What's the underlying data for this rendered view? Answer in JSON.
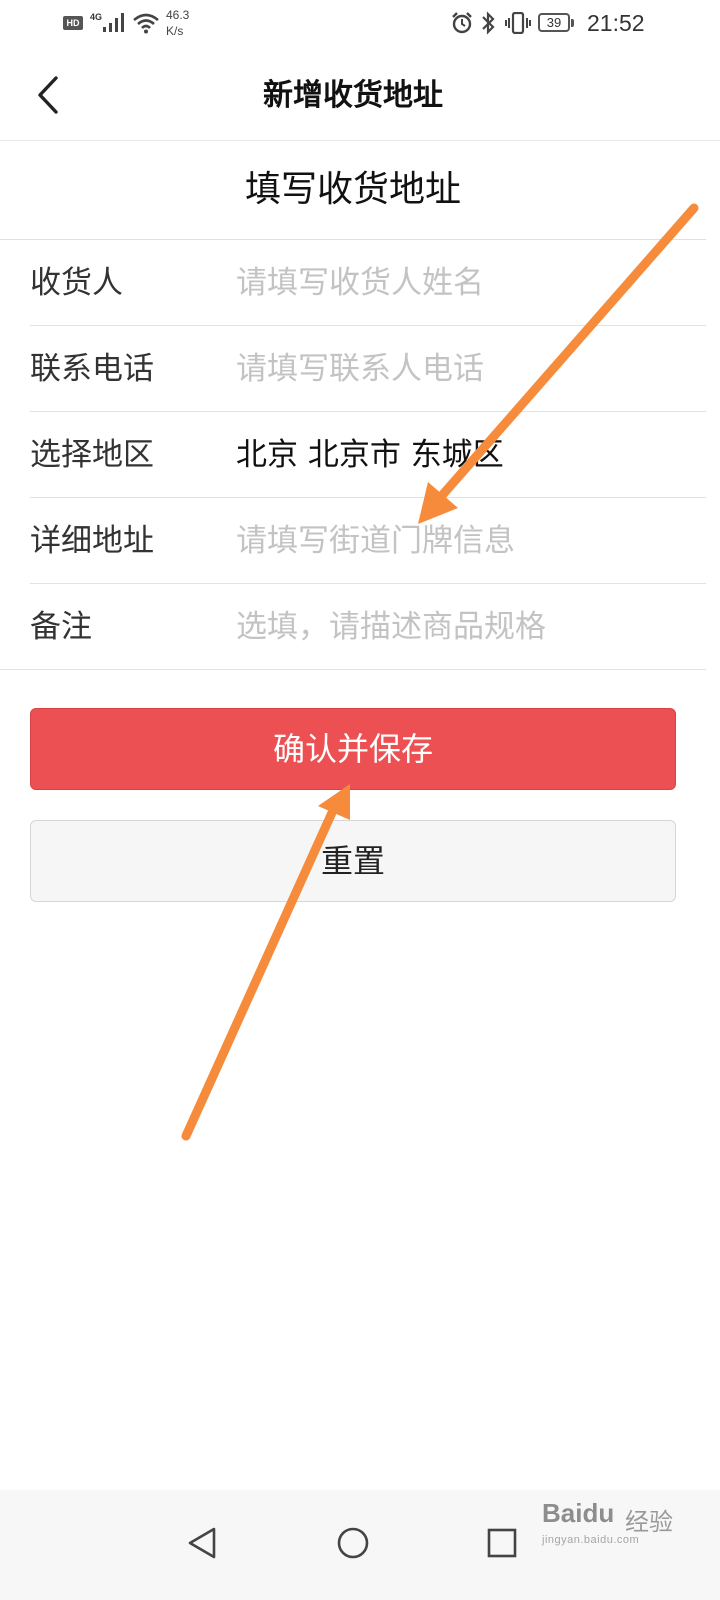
{
  "status_bar": {
    "hd": "HD",
    "network": "4G",
    "speed_value": "46.3",
    "speed_unit": "K/s",
    "battery": "39",
    "time": "21:52"
  },
  "header": {
    "title": "新增收货地址"
  },
  "form": {
    "title": "填写收货地址",
    "fields": [
      {
        "label": "收货人",
        "placeholder": "请填写收货人姓名",
        "value": ""
      },
      {
        "label": "联系电话",
        "placeholder": "请填写联系人电话",
        "value": ""
      },
      {
        "label": "选择地区",
        "value": "北京 北京市 东城区"
      },
      {
        "label": "详细地址",
        "placeholder": "请填写街道门牌信息",
        "value": ""
      },
      {
        "label": "备注",
        "placeholder": "选填，请描述商品规格",
        "value": ""
      }
    ]
  },
  "actions": {
    "save_label": "确认并保存",
    "reset_label": "重置"
  },
  "watermark": {
    "brand": "Baidu",
    "suffix": "经验",
    "url": "jingyan.baidu.com"
  },
  "colors": {
    "accent": "#ed5053",
    "annotation": "#f68b3b"
  }
}
